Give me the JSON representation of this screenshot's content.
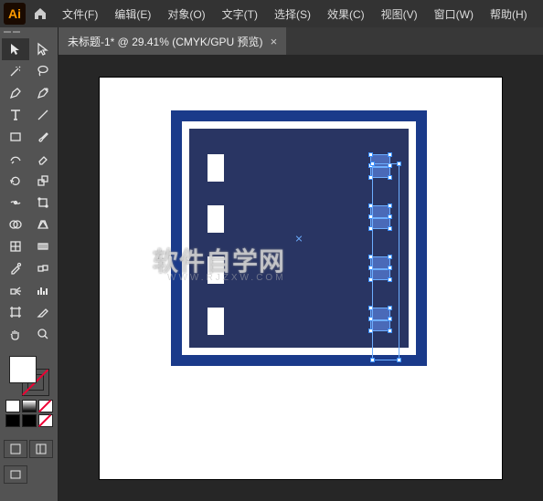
{
  "app": {
    "logo": "Ai"
  },
  "menu": {
    "file": "文件(F)",
    "edit": "编辑(E)",
    "object": "对象(O)",
    "type": "文字(T)",
    "select": "选择(S)",
    "effect": "效果(C)",
    "view": "视图(V)",
    "window": "窗口(W)",
    "help": "帮助(H)"
  },
  "tab": {
    "title": "未标题-1* @ 29.41% (CMYK/GPU 预览)",
    "close": "×"
  },
  "tools": {
    "selection": "selection",
    "direct_selection": "direct-selection",
    "magic_wand": "magic-wand",
    "lasso": "lasso",
    "pen": "pen",
    "curvature": "curvature",
    "type": "type",
    "line": "line",
    "rectangle": "rectangle",
    "paintbrush": "paintbrush",
    "shaper": "shaper",
    "eraser": "eraser",
    "rotate": "rotate",
    "scale": "scale",
    "width": "width",
    "free_transform": "free-transform",
    "shape_builder": "shape-builder",
    "perspective": "perspective",
    "mesh": "mesh",
    "gradient": "gradient",
    "eyedropper": "eyedropper",
    "blend": "blend",
    "symbol_sprayer": "symbol-sprayer",
    "column_graph": "column-graph",
    "artboard": "artboard",
    "slice": "slice",
    "hand": "hand",
    "zoom": "zoom"
  },
  "watermark": {
    "main": "软件自学网",
    "sub": "WWW.RJZXW.COM"
  },
  "chart_data": {
    "type": "diagram",
    "description": "Vector artwork on white artboard: outer blue square with white inset border, dark navy fill. Left column has 4 white rectangles; right column has 4 selected light-blue objects with transform handles.",
    "colors": {
      "outer_blue": "#1a3a8a",
      "inner_navy": "#293563",
      "selection": "#6daeff",
      "white": "#ffffff"
    },
    "left_rect_count": 4,
    "right_selected_count": 4,
    "zoom_percent": 29.41,
    "color_mode": "CMYK"
  }
}
